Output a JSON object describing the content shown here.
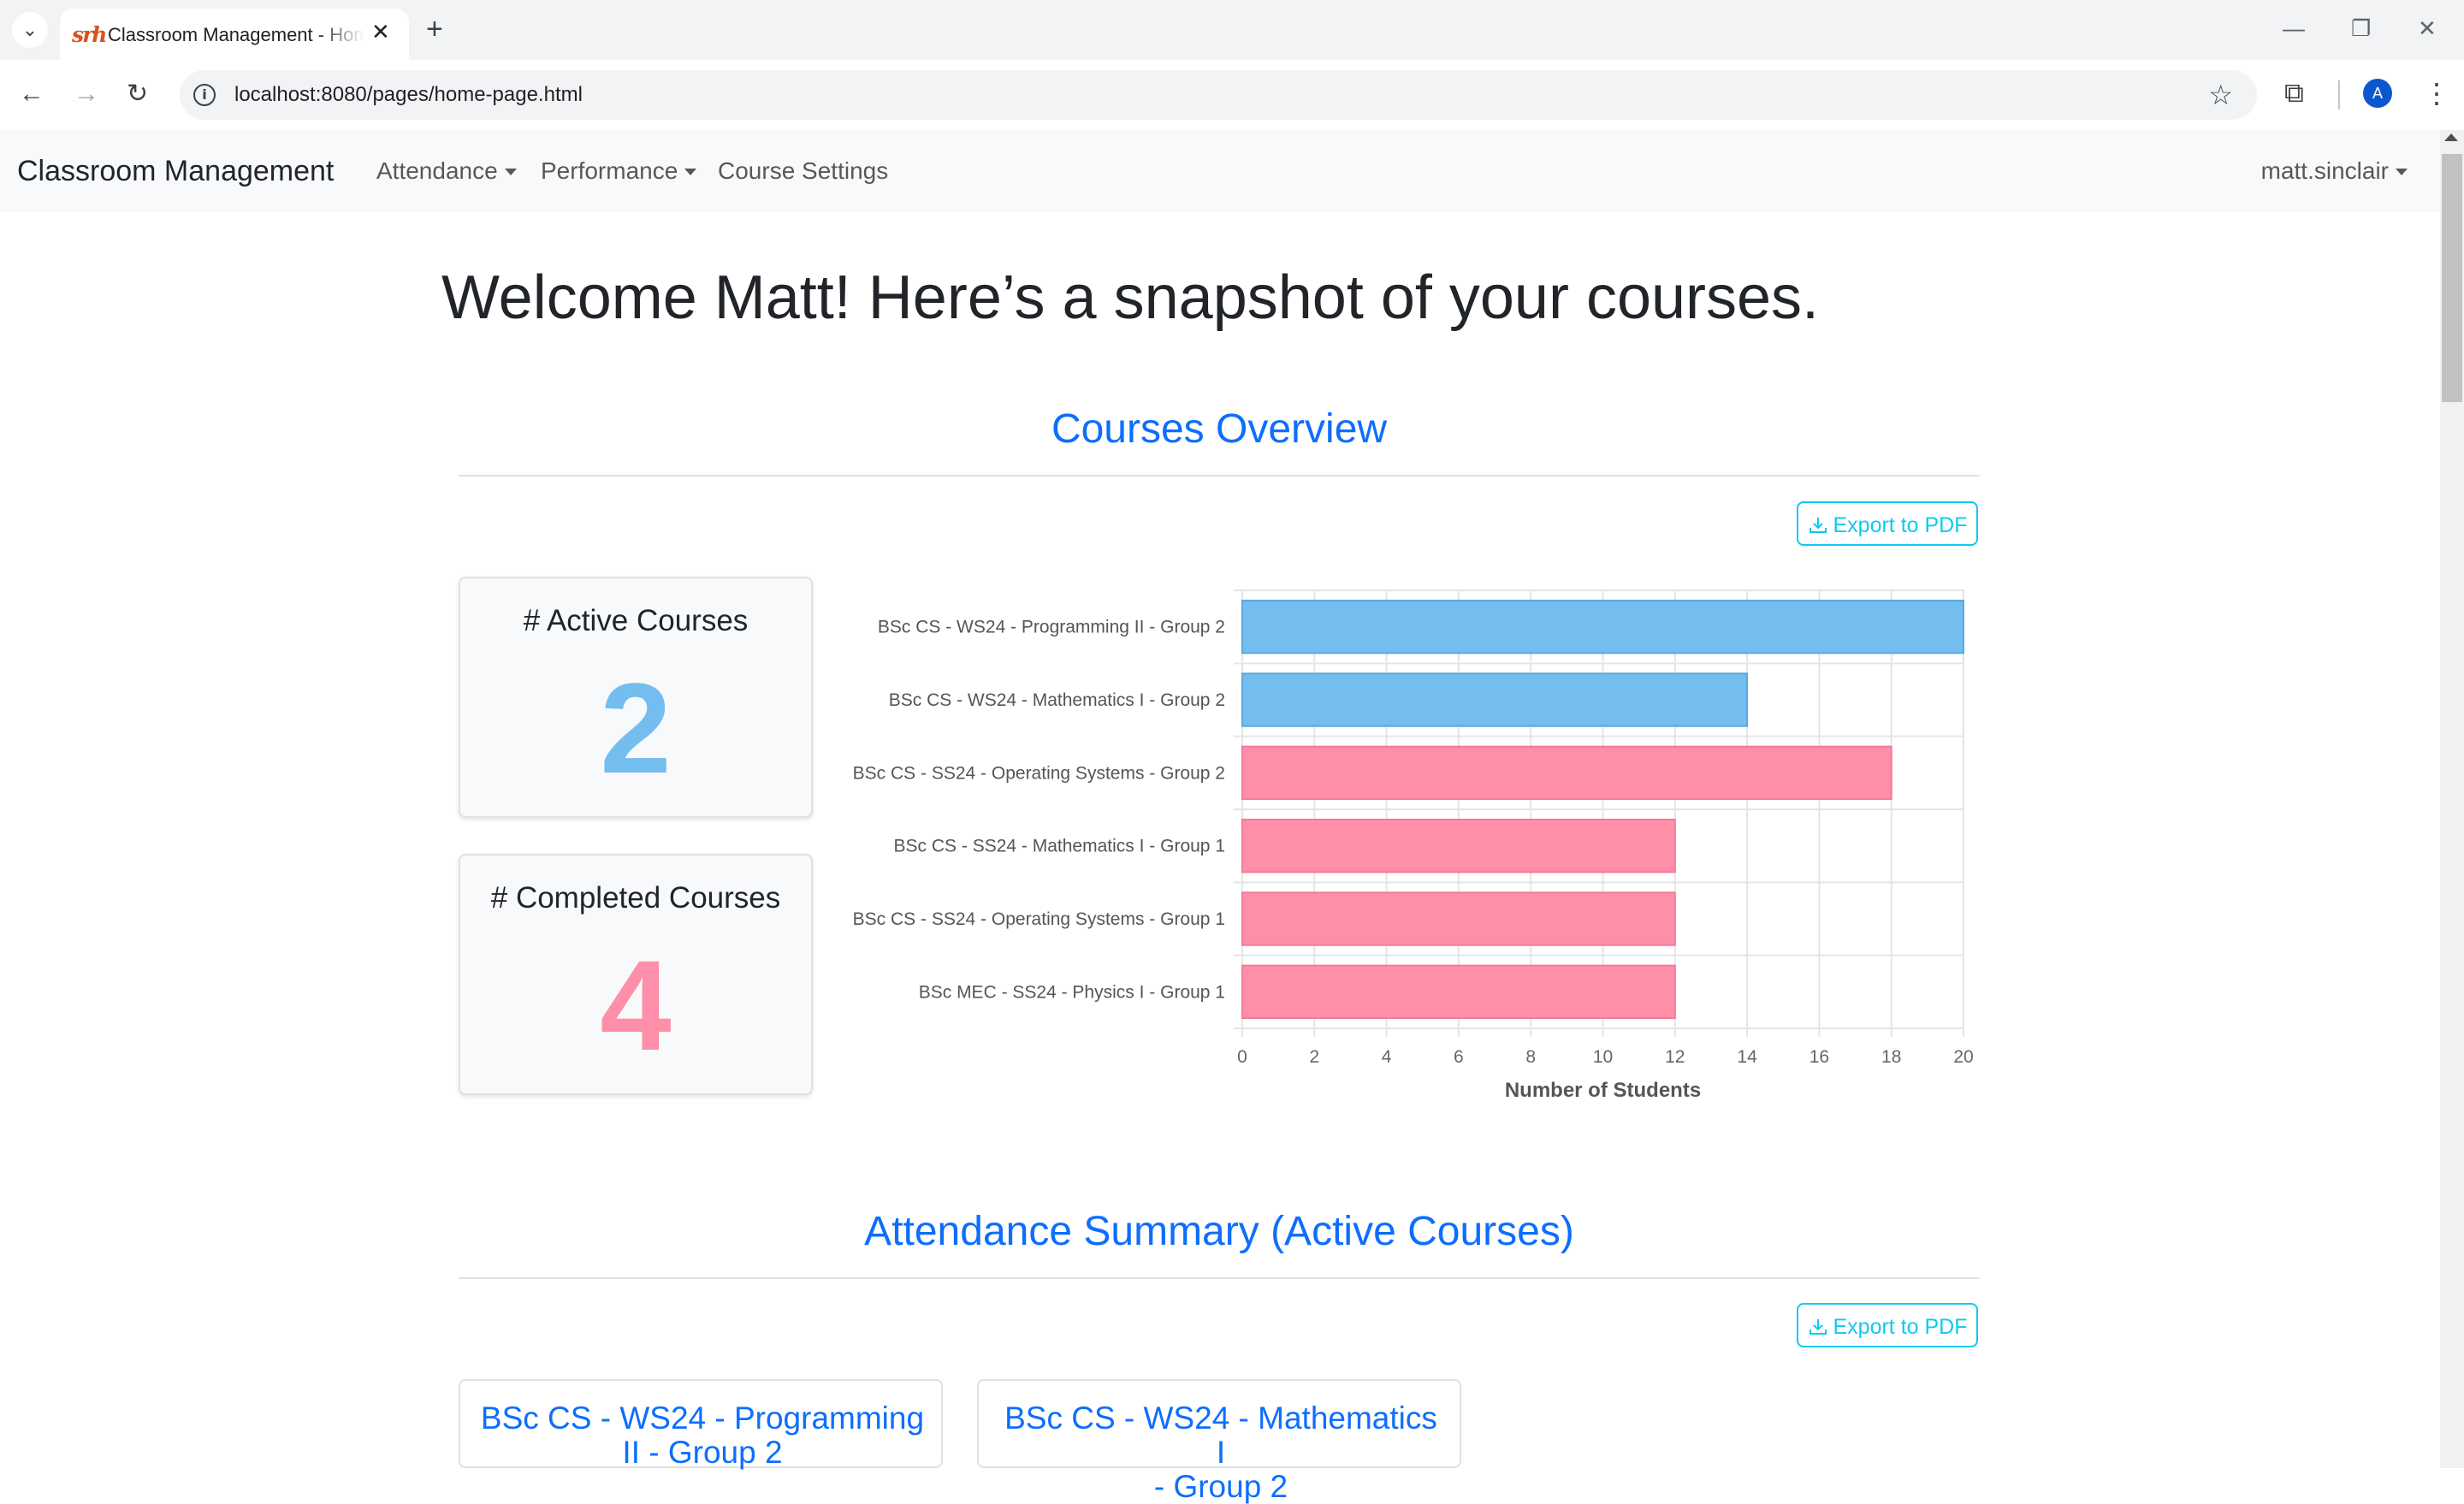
{
  "browser": {
    "tab_title": "Classroom Management - Home",
    "favicon_text": "srh",
    "url": "localhost:8080/pages/home-page.html",
    "profile_initial": "A"
  },
  "navbar": {
    "brand": "Classroom Management",
    "menu": [
      {
        "label": "Attendance"
      },
      {
        "label": "Performance"
      },
      {
        "label": "Course Settings"
      }
    ],
    "user": "matt.sinclair"
  },
  "welcome": "Welcome Matt! Here’s a snapshot of your courses.",
  "overview": {
    "title": "Courses Overview",
    "export_label": "Export to PDF",
    "active_label": "# Active Courses",
    "active_count": "2",
    "completed_label": "# Completed Courses",
    "completed_count": "4"
  },
  "chart_data": {
    "type": "bar",
    "orientation": "horizontal",
    "categories": [
      "BSc CS - WS24 - Programming II - Group 2",
      "BSc CS - WS24 - Mathematics I - Group 2",
      "BSc CS - SS24 - Operating Systems - Group 2",
      "BSc CS - SS24 - Mathematics I - Group 1",
      "BSc CS - SS24 - Operating Systems - Group 1",
      "BSc MEC - SS24 - Physics I - Group 1"
    ],
    "values": [
      20,
      14,
      18,
      12,
      12,
      12
    ],
    "bar_colors": [
      "#74bdef",
      "#74bdef",
      "#ff8fa8",
      "#ff8fa8",
      "#ff8fa8",
      "#ff8fa8"
    ],
    "xlabel": "Number of Students",
    "xlim": [
      0,
      20
    ],
    "xticks": [
      "0",
      "2",
      "4",
      "6",
      "8",
      "10",
      "12",
      "14",
      "16",
      "18",
      "20"
    ],
    "grid": true
  },
  "attendance": {
    "title": "Attendance Summary (Active Courses)",
    "export_label": "Export to PDF",
    "courses": [
      {
        "line1": "BSc CS - WS24 - Programming",
        "line2": "II - Group 2"
      },
      {
        "line1": "BSc CS - WS24 - Mathematics I",
        "line2": "- Group 2"
      }
    ]
  },
  "colors": {
    "primary": "#0d6efd",
    "info": "#0dcaf0",
    "active_blue": "#74bdef",
    "completed_pink": "#ff8fa8"
  }
}
